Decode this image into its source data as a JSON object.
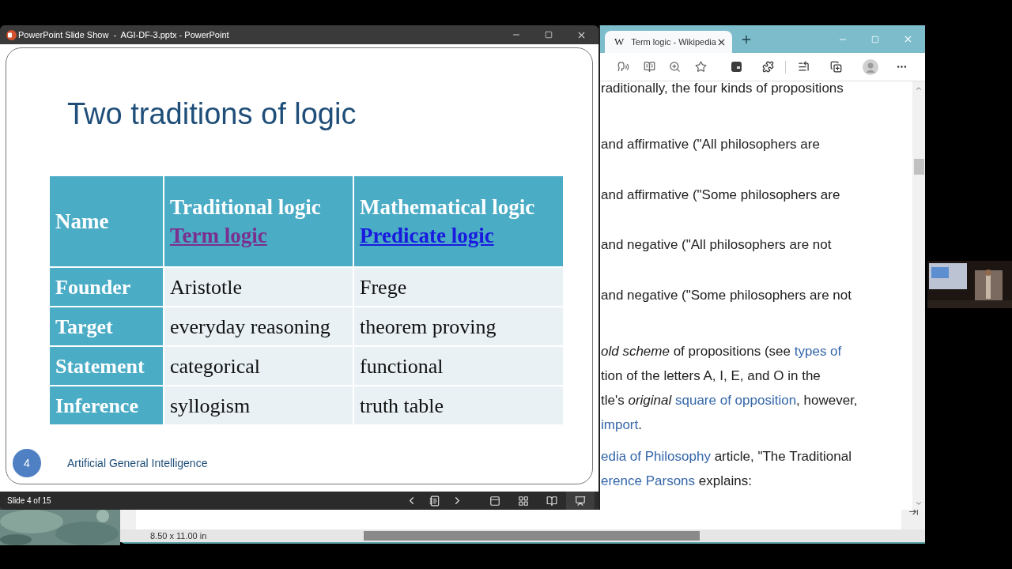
{
  "powerpoint_window": {
    "title": "PowerPoint Slide Show  -  AGI-DF-3.pptx - PowerPoint",
    "slide": {
      "title": "Two traditions of logic",
      "table": {
        "header": [
          {
            "text": "Name"
          },
          {
            "text": "Traditional logic",
            "link": "Term logic",
            "visited": true
          },
          {
            "text": "Mathematical logic",
            "link": "Predicate logic",
            "visited": false
          }
        ],
        "rows": [
          [
            "Founder",
            "Aristotle",
            "Frege"
          ],
          [
            "Target",
            "everyday reasoning",
            "theorem proving"
          ],
          [
            "Statement",
            "categorical",
            "functional"
          ],
          [
            "Inference",
            "syllogism",
            "truth table"
          ]
        ]
      },
      "slide_number": "4",
      "footer": "Artificial General Intelligence"
    },
    "status_bar": {
      "slide_counter": "Slide 4 of 15",
      "views": [
        {
          "kind": "normal",
          "selected": false
        },
        {
          "kind": "sorter",
          "selected": false
        },
        {
          "kind": "reading",
          "selected": false
        },
        {
          "kind": "slideshow",
          "selected": true
        }
      ]
    }
  },
  "browser_window": {
    "tab": {
      "favicon": "W",
      "title": "Term logic - Wikipedia"
    },
    "article": [
      {
        "kind": "paragraph",
        "lines": [
          [
            {
              "kind": "text",
              "text": "raditionally, the four kinds of propositions"
            }
          ]
        ]
      },
      {
        "kind": "list",
        "lines": [
          [
            {
              "kind": "text",
              "text": "and affirmative (\"All philosophers are"
            }
          ]
        ]
      },
      {
        "kind": "list",
        "lines": [
          [
            {
              "kind": "text",
              "text": "and affirmative (\"Some philosophers are"
            }
          ]
        ]
      },
      {
        "kind": "list",
        "lines": [
          [
            {
              "kind": "text",
              "text": "and negative (\"All philosophers are not"
            }
          ]
        ]
      },
      {
        "kind": "list",
        "lines": [
          [
            {
              "kind": "text",
              "text": "and negative (\"Some philosophers are not"
            }
          ]
        ]
      },
      {
        "kind": "paragraph",
        "lines": [
          [
            {
              "kind": "italic",
              "text": "old scheme"
            },
            {
              "kind": "text",
              "text": " of propositions (see "
            },
            {
              "kind": "link",
              "text": "types of"
            }
          ],
          [
            {
              "kind": "text",
              "text": "tion of the letters A, I, E, and O in the"
            }
          ],
          [
            {
              "kind": "text",
              "text": "tle's "
            },
            {
              "kind": "italic",
              "text": "original "
            },
            {
              "kind": "link",
              "text": "square of opposition"
            },
            {
              "kind": "text",
              "text": ", however,"
            }
          ],
          [
            {
              "kind": "link",
              "text": "import"
            },
            {
              "kind": "text",
              "text": "."
            }
          ]
        ]
      },
      {
        "kind": "paragraph",
        "lines": [
          [
            {
              "kind": "link",
              "text": "edia of Philosophy"
            },
            {
              "kind": "text",
              "text": " article, \"The Traditional"
            }
          ],
          [
            {
              "kind": "link",
              "text": "erence Parsons"
            },
            {
              "kind": "text",
              "text": " explains:"
            }
          ]
        ]
      }
    ]
  },
  "document_window": {
    "page_size": "8.50 x 11.00 in"
  }
}
